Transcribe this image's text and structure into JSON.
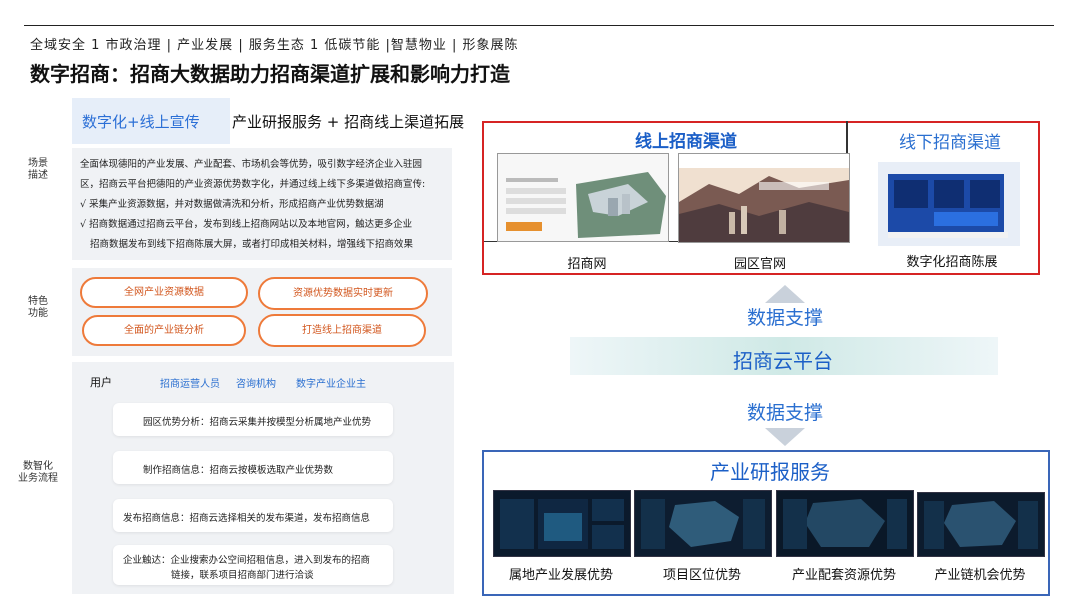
{
  "header": {
    "nav": "全域安全 1 市政治理 | 产业发展 | 服务生态 1 低碳节能 |智慧物业 | 形象展陈",
    "title": "数字招商：招商大数据助力招商渠道扩展和影响力打造"
  },
  "left": {
    "tag": "数字化+线上宣传",
    "heading": "产业研报服务 + 招商线上渠道拓展",
    "labels": {
      "scene": "场景\n描述",
      "features": "特色\n功能",
      "flow": "数智化\n业务流程"
    },
    "description": [
      "全面体现德阳的产业发展、产业配套、市场机会等优势，吸引数字经济企业入驻园",
      "区，招商云平台把德阳的产业资源优势数字化，并通过线上线下多渠道做招商宣传:",
      "√ 采集产业资源数据，并对数据做清洗和分析，形成招商产业优势数据湖",
      "√ 招商数据通过招商云平台，发布到线上招商网站以及本地官网，触达更多企业",
      "招商数据发布到线下招商陈展大屏，或者打印成相关材料，增强线下招商效果"
    ],
    "features": [
      "全网产业资源数据",
      "资源优势数据实时更新",
      "全面的产业链分析",
      "打造线上招商渠道"
    ],
    "users": {
      "label": "用户",
      "items": [
        "招商运营人员",
        "咨询机构",
        "数字产业企业主"
      ]
    },
    "flow": [
      {
        "lines": [
          "园区优势分析：招商云采集并按模型分析属地产业优势"
        ]
      },
      {
        "lines": [
          "制作招商信息：招商云按模板选取产业优势数"
        ]
      },
      {
        "lines": [
          "发布招商信息：招商云选择相关的发布渠道，发布招商信息"
        ]
      },
      {
        "lines": [
          "企业触达：企业搜索办公空间招租信息，进入到发布的招商",
          "链接，联系项目招商部门进行洽谈"
        ]
      }
    ]
  },
  "right": {
    "online_title": "线上招商渠道",
    "offline_title": "线下招商渠道",
    "captions": [
      "招商网",
      "园区官网",
      "数字化招商陈展"
    ],
    "support_top": "数据支撑",
    "platform": "招商云平台",
    "support_bottom": "数据支撑",
    "research_title": "产业研报服务",
    "research_captions": [
      "属地产业发展优势",
      "项目区位优势",
      "产业配套资源优势",
      "产业链机会优势"
    ]
  }
}
